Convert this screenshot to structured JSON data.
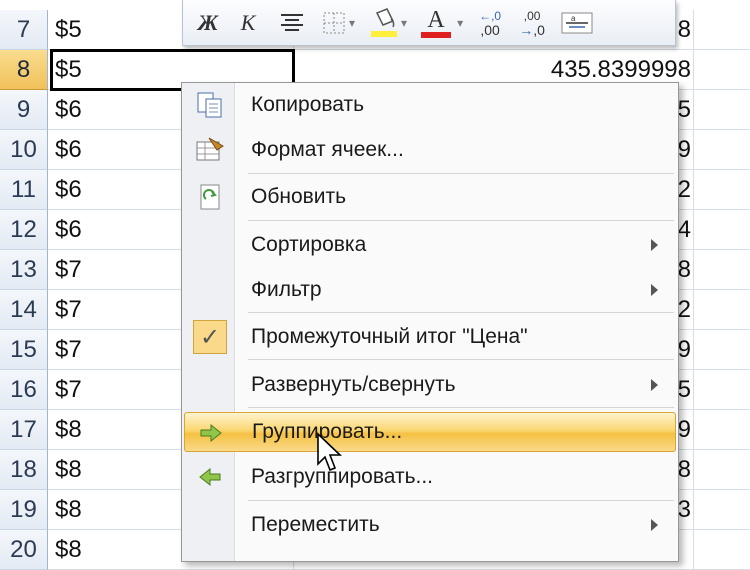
{
  "rows": [
    {
      "num": "7",
      "a": "$5",
      "b": "8"
    },
    {
      "num": "8",
      "a": "$5",
      "b": "435.8399998"
    },
    {
      "num": "9",
      "a": "$6",
      "b": "5"
    },
    {
      "num": "10",
      "a": "$6",
      "b": "9"
    },
    {
      "num": "11",
      "a": "$6",
      "b": "2"
    },
    {
      "num": "12",
      "a": "$6",
      "b": "4"
    },
    {
      "num": "13",
      "a": "$7",
      "b": "8"
    },
    {
      "num": "14",
      "a": "$7",
      "b": "2"
    },
    {
      "num": "15",
      "a": "$7",
      "b": "9"
    },
    {
      "num": "16",
      "a": "$7",
      "b": "5"
    },
    {
      "num": "17",
      "a": "$8",
      "b": "9"
    },
    {
      "num": "18",
      "a": "$8",
      "b": "8"
    },
    {
      "num": "19",
      "a": "$8",
      "b": "3"
    },
    {
      "num": "20",
      "a": "$8",
      "b": ""
    }
  ],
  "toolbar": {
    "bold": "Ж",
    "italic": "К",
    "font_color_letter": "A",
    "inc_decimal": ",00",
    "dec_decimal": ",0",
    "colors": {
      "highlight": "#ffef3a",
      "font": "#e02020"
    }
  },
  "menu": {
    "copy": "Копировать",
    "format_cells": "Формат ячеек...",
    "refresh": "Обновить",
    "sort": "Сортировка",
    "filter": "Фильтр",
    "subtotal": "Промежуточный итог \"Цена\"",
    "expand_collapse": "Развернуть/свернуть",
    "group": "Группировать...",
    "ungroup": "Разгруппировать...",
    "move": "Переместить",
    "check_mark": "✓"
  }
}
